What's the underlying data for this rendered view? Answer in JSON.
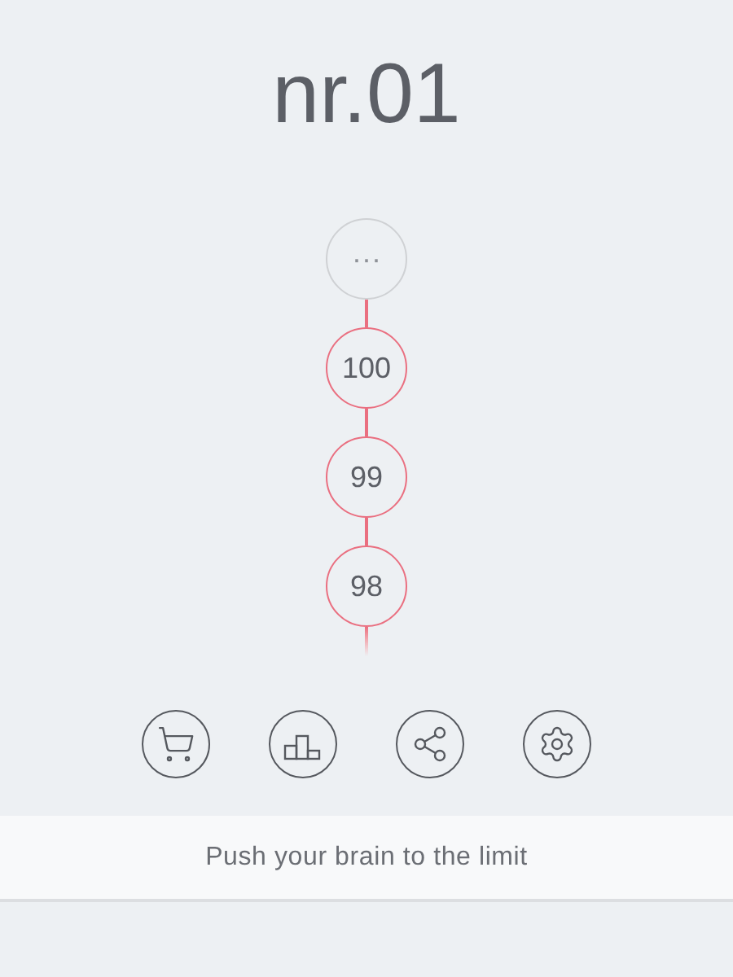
{
  "title": "nr.01",
  "levels": [
    {
      "label": "···",
      "locked": true
    },
    {
      "label": "100",
      "locked": false
    },
    {
      "label": "99",
      "locked": false
    },
    {
      "label": "98",
      "locked": false
    }
  ],
  "buttons": [
    {
      "kind": "shop"
    },
    {
      "kind": "leaderboard"
    },
    {
      "kind": "share"
    },
    {
      "kind": "settings"
    }
  ],
  "tagline": "Push your brain to the limit"
}
